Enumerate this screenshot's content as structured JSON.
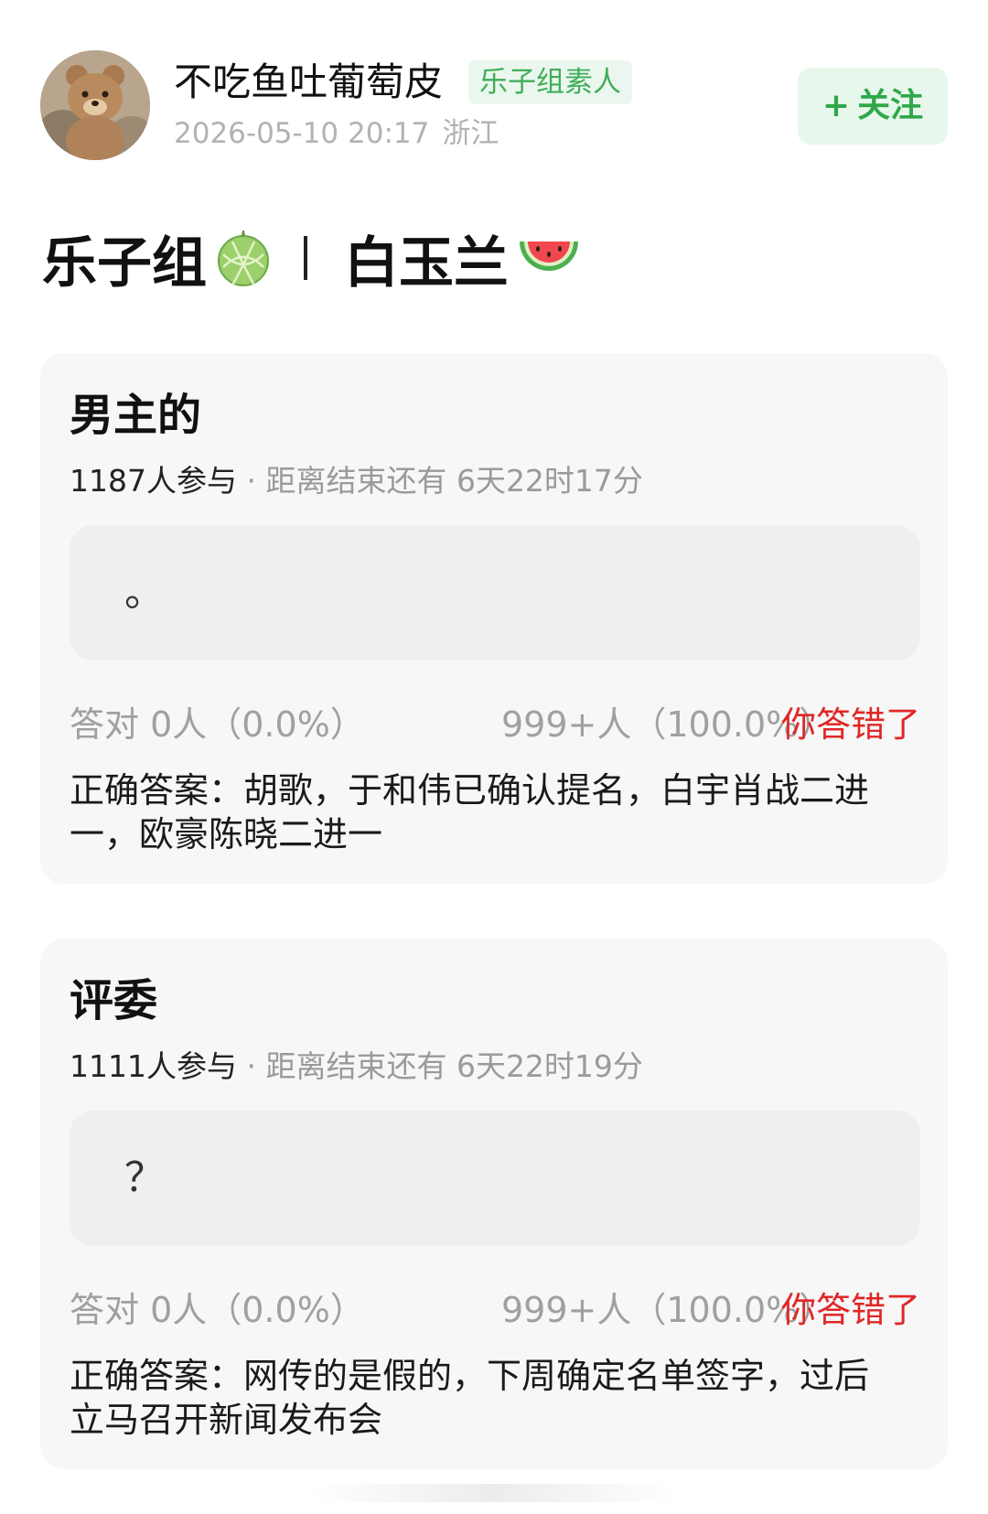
{
  "user": {
    "name": "不吃鱼吐葡萄皮",
    "badge": "乐子组素人",
    "time": "2026-05-10 20:17",
    "location": "浙江"
  },
  "follow": {
    "plus": "+",
    "label": "关注"
  },
  "post": {
    "title_left": "乐子组",
    "title_right": "白玉兰",
    "emoji_left": "melon",
    "emoji_right": "watermelon"
  },
  "quizzes": [
    {
      "title": "男主的",
      "participants": "1187人参与",
      "countdown": " · 距离结束还有 6天22时17分",
      "option": "。",
      "correct_label": "答对  0人（0.0%）",
      "wrong_label": "999+人（100.0%）",
      "result": "你答错了",
      "answer": "正确答案：胡歌，于和伟已确认提名，白宇肖战二进一，欧豪陈晓二进一"
    },
    {
      "title": "评委",
      "participants": "1111人参与",
      "countdown": " · 距离结束还有 6天22时19分",
      "option": "？",
      "correct_label": "答对  0人（0.0%）",
      "wrong_label": "999+人（100.0%）",
      "result": "你答错了",
      "answer": "正确答案：网传的是假的，下周确定名单签字，过后立马召开新闻发布会"
    }
  ],
  "colors": {
    "accent_green": "#2fa84a",
    "badge_green": "#3fae5a",
    "error_red": "#e02727",
    "card_bg": "#f7f7f7",
    "muted_text": "#a0a0a0"
  }
}
